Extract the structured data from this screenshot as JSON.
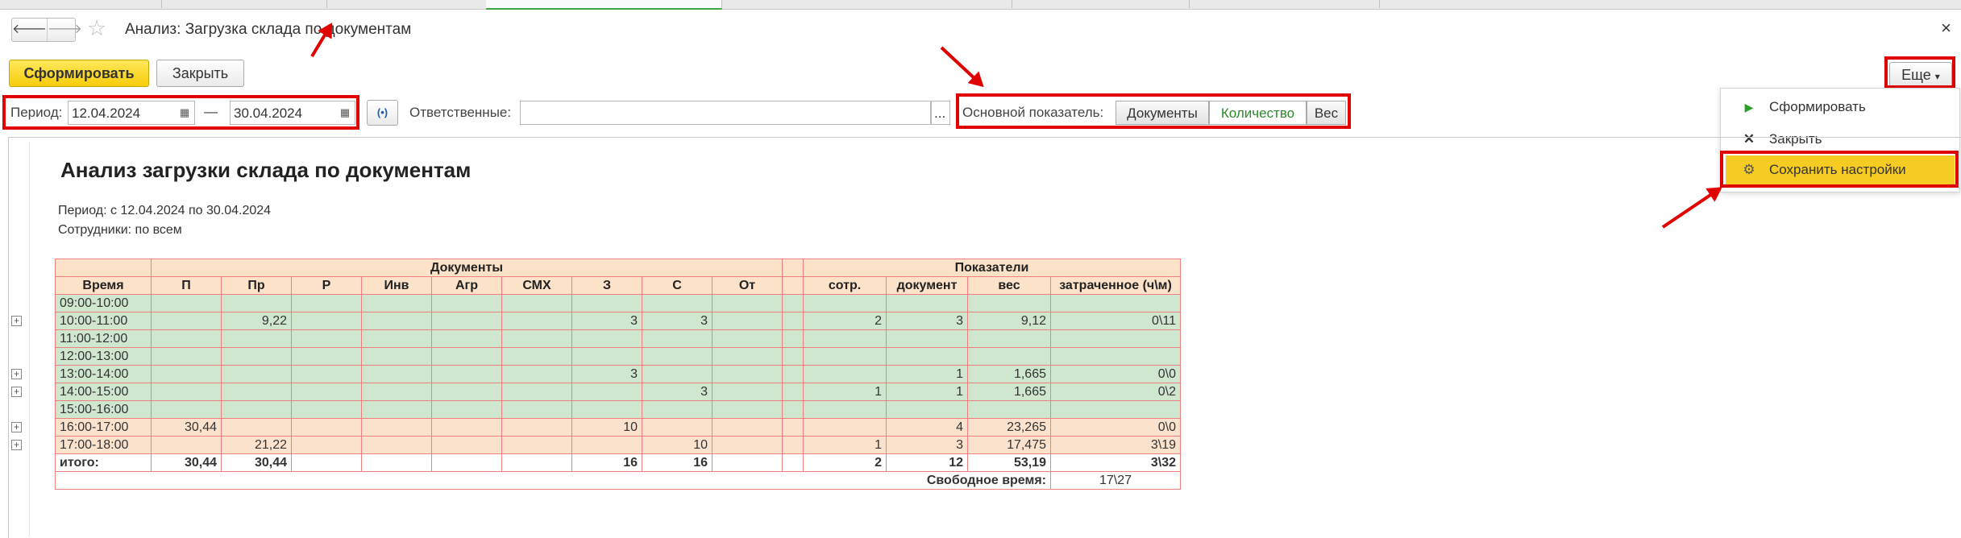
{
  "window": {
    "title": "Анализ: Загрузка склада по документам",
    "close_glyph": "×",
    "back_glyph": "🡐",
    "forward_glyph": "🡒",
    "star_glyph": "☆"
  },
  "toolbar": {
    "generate_label": "Сформировать",
    "close_label": "Закрыть",
    "more_label": "Еще",
    "more_arrow": "▾"
  },
  "filters": {
    "period_label": "Период:",
    "date_from": "12.04.2024",
    "dash": "—",
    "date_to": "30.04.2024",
    "calendar_glyph": "▦",
    "link_glyph": "(•)",
    "responsible_label": "Ответственные:",
    "responsible_value": "",
    "ellipsis": "...",
    "indicator_label": "Основной показатель:",
    "indicator_options": [
      "Документы",
      "Количество",
      "Вес"
    ],
    "indicator_selected": "Количество"
  },
  "menu": {
    "items": [
      {
        "label": "Сформировать",
        "icon": "play-icon",
        "glyph": "▶"
      },
      {
        "label": "Закрыть",
        "icon": "close-icon",
        "glyph": "✕"
      },
      {
        "label": "Сохранить настройки",
        "icon": "save-settings-icon",
        "glyph": "⚙"
      }
    ]
  },
  "report": {
    "title": "Анализ загрузки склада по документам",
    "period_line": "Период: с 12.04.2024 по 30.04.2024",
    "employees_line": "Сотрудники: по всем",
    "group_documents": "Документы",
    "group_indicators": "Показатели",
    "columns": [
      "Время",
      "П",
      "Пр",
      "Р",
      "Инв",
      "Агр",
      "СМХ",
      "З",
      "С",
      "От",
      "",
      "сотр.",
      "документ",
      "вес",
      "затраченное (ч\\м)"
    ],
    "rows": [
      {
        "cells": [
          "09:00-10:00",
          "",
          "",
          "",
          "",
          "",
          "",
          "",
          "",
          "",
          "",
          "",
          "",
          "",
          ""
        ]
      },
      {
        "cells": [
          "10:00-11:00",
          "",
          "9,22",
          "",
          "",
          "",
          "",
          "3",
          "3",
          "",
          "",
          "2",
          "3",
          "9,12",
          "0\\11"
        ]
      },
      {
        "cells": [
          "11:00-12:00",
          "",
          "",
          "",
          "",
          "",
          "",
          "",
          "",
          "",
          "",
          "",
          "",
          "",
          ""
        ]
      },
      {
        "cells": [
          "12:00-13:00",
          "",
          "",
          "",
          "",
          "",
          "",
          "",
          "",
          "",
          "",
          "",
          "",
          "",
          ""
        ]
      },
      {
        "cells": [
          "13:00-14:00",
          "",
          "",
          "",
          "",
          "",
          "",
          "3",
          "",
          "",
          "",
          "",
          "1",
          "1,665",
          "0\\0"
        ]
      },
      {
        "cells": [
          "14:00-15:00",
          "",
          "",
          "",
          "",
          "",
          "",
          "",
          "3",
          "",
          "",
          "1",
          "1",
          "1,665",
          "0\\2"
        ]
      },
      {
        "cells": [
          "15:00-16:00",
          "",
          "",
          "",
          "",
          "",
          "",
          "",
          "",
          "",
          "",
          "",
          "",
          "",
          ""
        ]
      },
      {
        "cells": [
          "16:00-17:00",
          "30,44",
          "",
          "",
          "",
          "",
          "",
          "10",
          "",
          "",
          "",
          "",
          "4",
          "23,265",
          "0\\0"
        ]
      },
      {
        "cells": [
          "17:00-18:00",
          "",
          "21,22",
          "",
          "",
          "",
          "",
          "",
          "10",
          "",
          "",
          "1",
          "3",
          "17,475",
          "3\\19"
        ]
      }
    ],
    "total": {
      "cells": [
        "итого:",
        "30,44",
        "30,44",
        "",
        "",
        "",
        "",
        "16",
        "16",
        "",
        "",
        "2",
        "12",
        "53,19",
        "3\\32"
      ]
    },
    "free_time_label": "Свободное время:",
    "free_time_value": "17\\27",
    "expand_glyph": "+"
  }
}
